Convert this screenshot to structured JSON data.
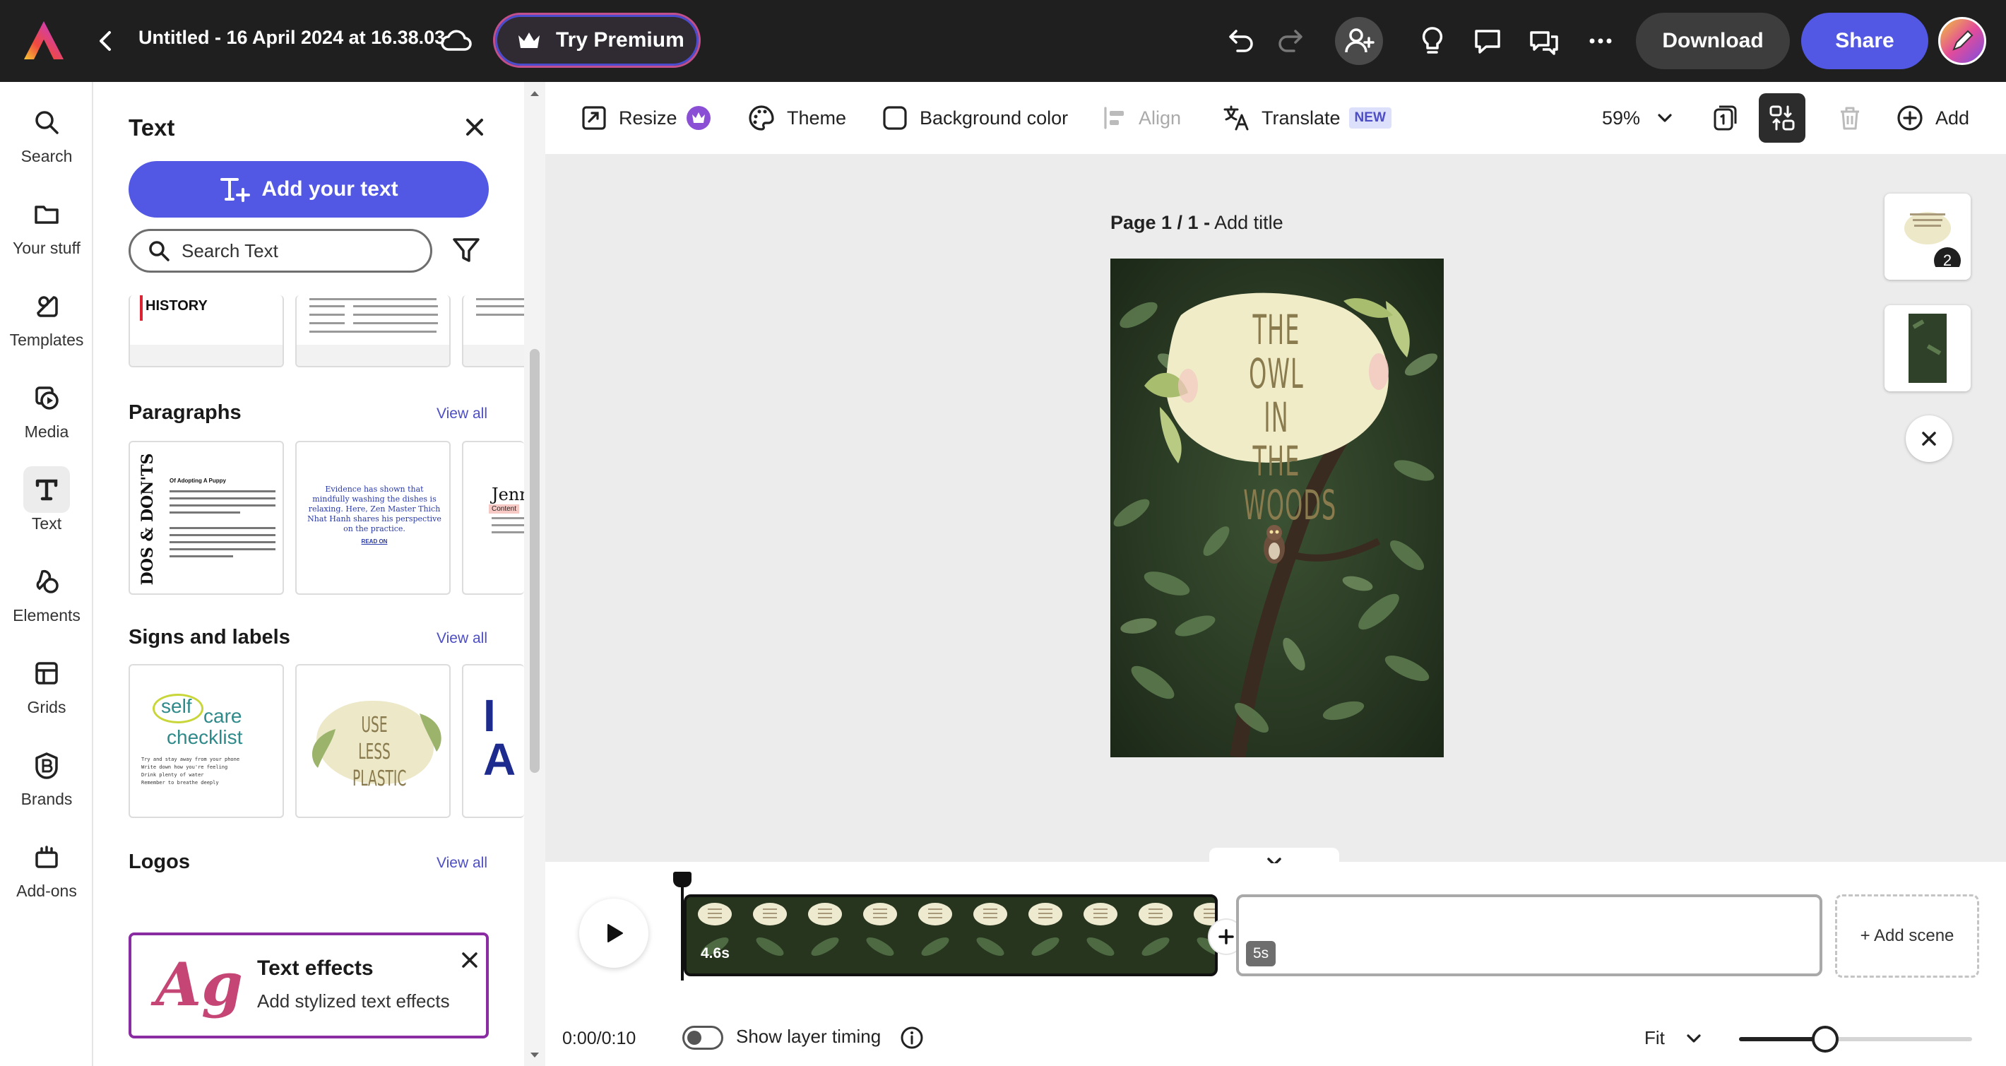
{
  "header": {
    "doc_title": "Untitled - 16 April 2024 at 16.38.03",
    "premium_label": "Try Premium",
    "download_label": "Download",
    "share_label": "Share"
  },
  "rail": {
    "items": [
      {
        "label": "Search",
        "icon": "search-icon"
      },
      {
        "label": "Your stuff",
        "icon": "folder-icon"
      },
      {
        "label": "Templates",
        "icon": "templates-icon"
      },
      {
        "label": "Media",
        "icon": "media-icon"
      },
      {
        "label": "Text",
        "icon": "text-icon"
      },
      {
        "label": "Elements",
        "icon": "elements-icon"
      },
      {
        "label": "Grids",
        "icon": "grids-icon"
      },
      {
        "label": "Brands",
        "icon": "brands-icon"
      },
      {
        "label": "Add-ons",
        "icon": "addons-icon"
      }
    ],
    "active": "Text"
  },
  "panel": {
    "title": "Text",
    "add_text_label": "Add your text",
    "search_placeholder": "Search Text",
    "sections": [
      {
        "title": "Paragraphs",
        "view_all": "View all"
      },
      {
        "title": "Signs and labels",
        "view_all": "View all"
      },
      {
        "title": "Logos",
        "view_all": "View all"
      }
    ],
    "top_thumb_text": "HISTORY",
    "paragraph_thumbs": {
      "t1_vertical": "DOS & DON'TS",
      "t1_heading": "Of Adopting A Puppy",
      "t2_text": "Evidence has shown that mindfully washing the dishes is relaxing. Here, Zen Master Thich Nhat Hanh shares his perspective on the practice.",
      "t2_link": "READ ON",
      "t3_name": "Jenn",
      "t3_role": "Content"
    },
    "sign_thumbs": {
      "s1_a": "self",
      "s1_b": "care",
      "s1_c": "checklist",
      "s1_items": [
        "Try and stay away from your phone",
        "Write down how you're feeling",
        "Drink plenty of water",
        "Remember to breathe deeply"
      ],
      "s2": "USE LESS PLASTIC",
      "s3": "I A"
    },
    "effects": {
      "glyph": "Ag",
      "title": "Text effects",
      "subtitle": "Add stylized text effects"
    }
  },
  "toolbar": {
    "resize": "Resize",
    "theme": "Theme",
    "background_color": "Background color",
    "align": "Align",
    "translate": "Translate",
    "translate_badge": "NEW",
    "zoom": "59%",
    "add": "Add"
  },
  "canvas": {
    "page_label_bold": "Page 1 / 1 -",
    "page_label_action": "Add title",
    "design_title": "THE OWL IN THE WOODS",
    "side_thumb_count": "2"
  },
  "timeline": {
    "clip1_duration": "4.6s",
    "clip2_duration": "5s",
    "add_scene": "+ Add scene",
    "time": "0:00/0:10",
    "show_layer_timing": "Show layer timing",
    "fit": "Fit",
    "zoom_level": 0.37
  },
  "colors": {
    "accent": "#5258e4",
    "premium_border": "#c14f8b",
    "topbar": "#1f1f1f",
    "canvas_bg": "#ececec"
  }
}
